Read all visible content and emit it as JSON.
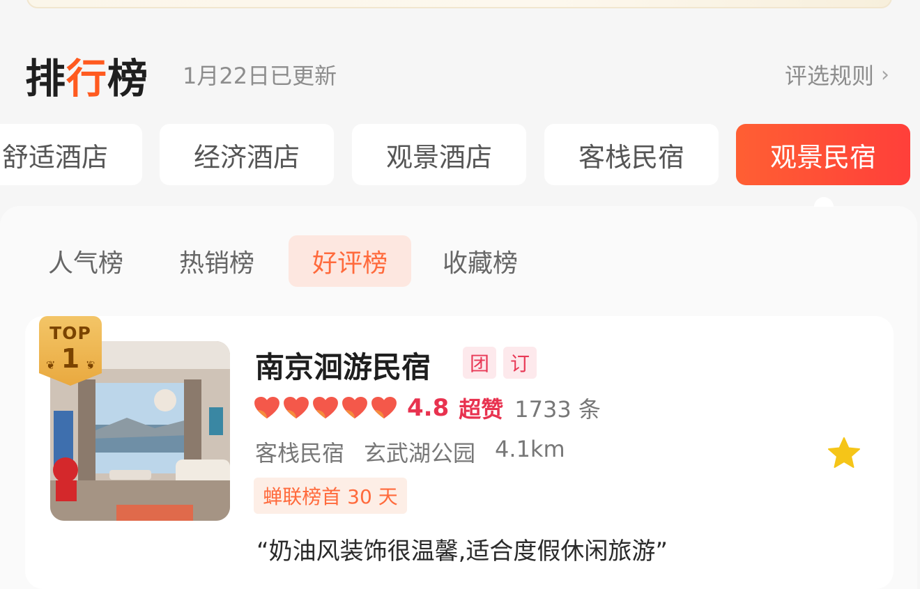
{
  "header": {
    "title_prefix": "排",
    "title_accent": "行",
    "title_suffix": "榜",
    "update_text": "1月22日已更新",
    "rules_label": "评选规则",
    "rules_chevron": "›"
  },
  "category_tabs": [
    {
      "label": "舒适酒店",
      "active": false
    },
    {
      "label": "经济酒店",
      "active": false
    },
    {
      "label": "观景酒店",
      "active": false
    },
    {
      "label": "客栈民宿",
      "active": false
    },
    {
      "label": "观景民宿",
      "active": true
    }
  ],
  "sub_tabs": [
    {
      "label": "人气榜",
      "active": false
    },
    {
      "label": "热销榜",
      "active": false
    },
    {
      "label": "好评榜",
      "active": true
    },
    {
      "label": "收藏榜",
      "active": false
    }
  ],
  "listing": {
    "badge_top": "TOP",
    "badge_rank": "1",
    "name": "南京洄游民宿",
    "tags": [
      "团",
      "订"
    ],
    "hearts": 5,
    "score": "4.8",
    "score_label": "超赞",
    "review_count": "1733 条",
    "type": "客栈民宿",
    "location": "玄武湖公园",
    "distance": "4.1km",
    "rank_note": "蝉联榜首 30 天",
    "quote": "“奶油风装饰很温馨,适合度假休闲旅游”",
    "favorite_icon": "star-icon"
  },
  "colors": {
    "accent_orange": "#ff5a1f",
    "rating_red": "#e8324f",
    "star_yellow": "#f5c518"
  }
}
